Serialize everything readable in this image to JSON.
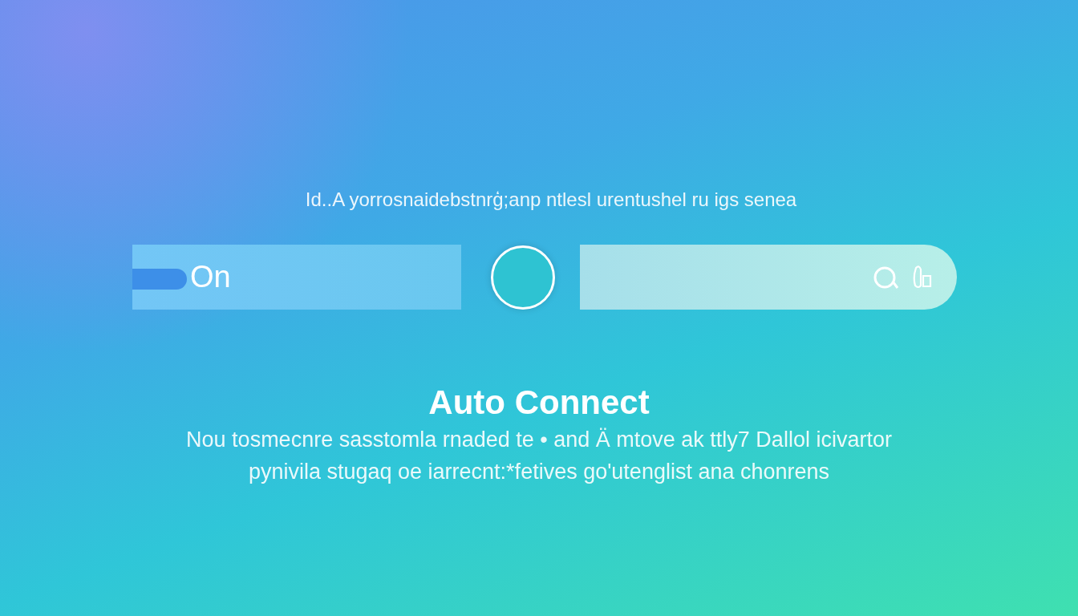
{
  "subtitle": "Id..A  yorrosnaidebstnrģ;anp ntlesl urentushel ru igs senea",
  "switch": {
    "label": "On",
    "on": true
  },
  "title": "Auto Connect",
  "description_lines": [
    "Nou tosmecnre sasstomla rnaded te • and Ä mtove ak ttly7 Dallol icivartor",
    "pynivila stugaq oe iarrecnt:*fetives go'utenglist ana chonrens"
  ]
}
